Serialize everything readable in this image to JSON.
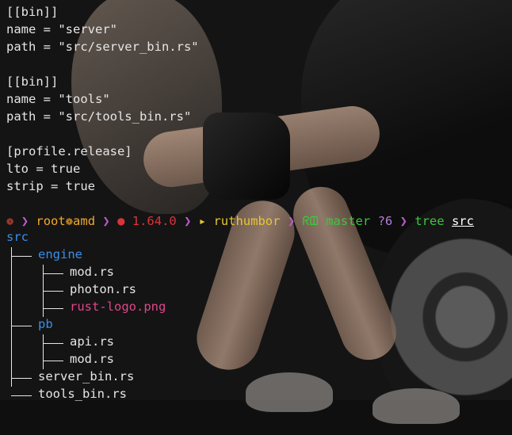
{
  "config_lines": [
    "[[bin]]",
    "name = \"server\"",
    "path = \"src/server_bin.rs\"",
    "",
    "[[bin]]",
    "name = \"tools\"",
    "path = \"src/tools_bin.rs\"",
    "",
    "[profile.release]",
    "lto = true",
    "strip = true",
    ""
  ],
  "prompt": {
    "os_icon": "❁",
    "sep": "❯",
    "user_host": "root❁amd",
    "rust_icon": "●",
    "rust_version": "1.64.0",
    "dir_icon": "▸",
    "directory": "ruthumbor",
    "git_icon": "ᖇᗶ",
    "branch": "master",
    "changes": "?6",
    "command": "tree",
    "argument": "src"
  },
  "tree": {
    "root": "src",
    "engine": {
      "name": "engine",
      "files": [
        "mod.rs",
        "photon.rs",
        "rust-logo.png"
      ]
    },
    "pb": {
      "name": "pb",
      "files": [
        "api.rs",
        "mod.rs"
      ]
    },
    "root_files": [
      "server_bin.rs",
      "tools_bin.rs"
    ]
  },
  "colors": {
    "directory": "#3a8ee8",
    "image_file": "#e0468a",
    "text": "#e6e6e6"
  }
}
